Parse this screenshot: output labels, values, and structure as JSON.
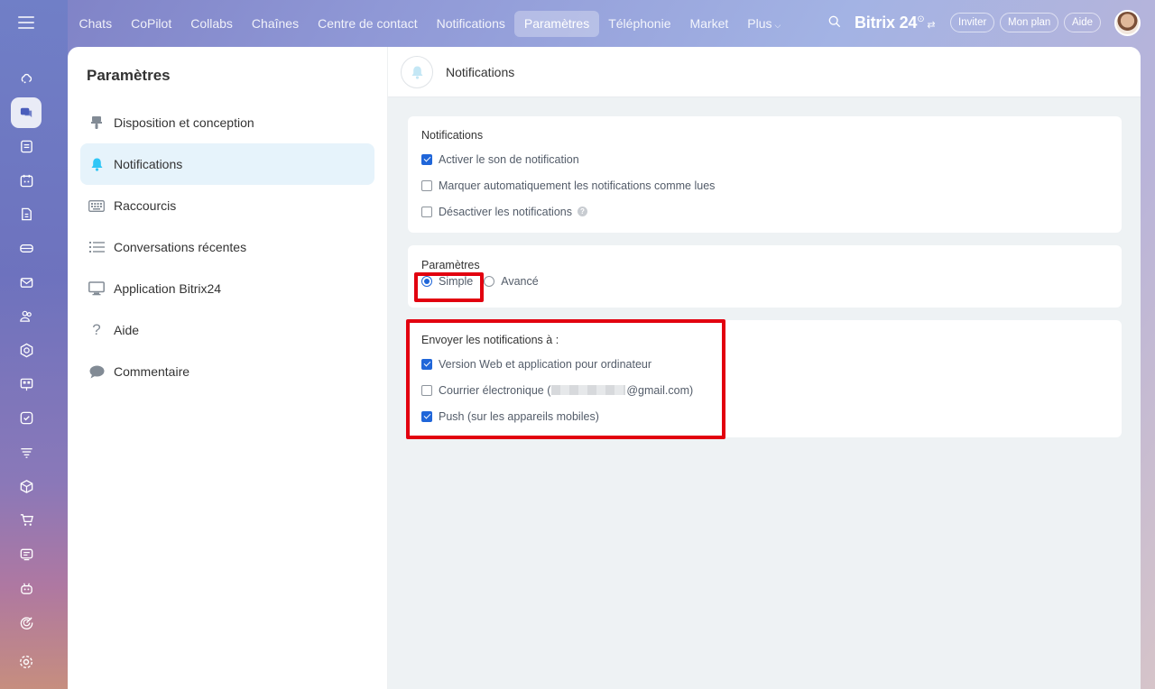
{
  "topbar": {
    "nav": [
      "Chats",
      "CoPilot",
      "Collabs",
      "Chaînes",
      "Centre de contact",
      "Notifications",
      "Paramètres",
      "Téléphonie",
      "Market",
      "Plus"
    ],
    "active_nav": "Paramètres",
    "brand": "Bitrix 24",
    "invite": "Inviter",
    "plan": "Mon plan",
    "help": "Aide"
  },
  "rail": {
    "icons": [
      "copilot-icon",
      "chat-icon",
      "feed-icon",
      "calendar-icon",
      "documents-icon",
      "drive-icon",
      "mail-icon",
      "groups-icon",
      "crm-icon",
      "board-icon",
      "tasks-icon",
      "marketing-icon",
      "store-icon",
      "cart-icon",
      "contact-center-icon",
      "bot-icon",
      "goals-icon"
    ],
    "active": "chat-icon"
  },
  "sidebar": {
    "title": "Paramètres",
    "items": [
      {
        "label": "Disposition et conception",
        "icon": "brush-icon"
      },
      {
        "label": "Notifications",
        "icon": "bell-icon",
        "active": true
      },
      {
        "label": "Raccourcis",
        "icon": "keyboard-icon"
      },
      {
        "label": "Conversations récentes",
        "icon": "list-icon"
      },
      {
        "label": "Application Bitrix24",
        "icon": "monitor-icon"
      },
      {
        "label": "Aide",
        "icon": "question-icon"
      },
      {
        "label": "Commentaire",
        "icon": "comment-icon"
      }
    ]
  },
  "main": {
    "title": "Notifications",
    "notifications": {
      "title": "Notifications",
      "options": [
        {
          "label": "Activer le son de notification",
          "checked": true
        },
        {
          "label": "Marquer automatiquement les notifications comme lues",
          "checked": false
        },
        {
          "label": "Désactiver les notifications",
          "checked": false
        }
      ]
    },
    "params": {
      "title": "Paramètres",
      "simple": "Simple",
      "advanced": "Avancé",
      "selected": "Simple"
    },
    "send": {
      "title": "Envoyer les notifications à :",
      "web": "Version Web et application pour ordinateur",
      "email_prefix": "Courrier électronique (",
      "email_suffix": "@gmail.com)",
      "push": "Push (sur les appareils mobiles)",
      "checked": {
        "web": true,
        "email": false,
        "push": true
      }
    }
  },
  "colors": {
    "accent": "#2066d9",
    "highlight": "#e2000f",
    "active_menu": "#e6f3fb"
  }
}
